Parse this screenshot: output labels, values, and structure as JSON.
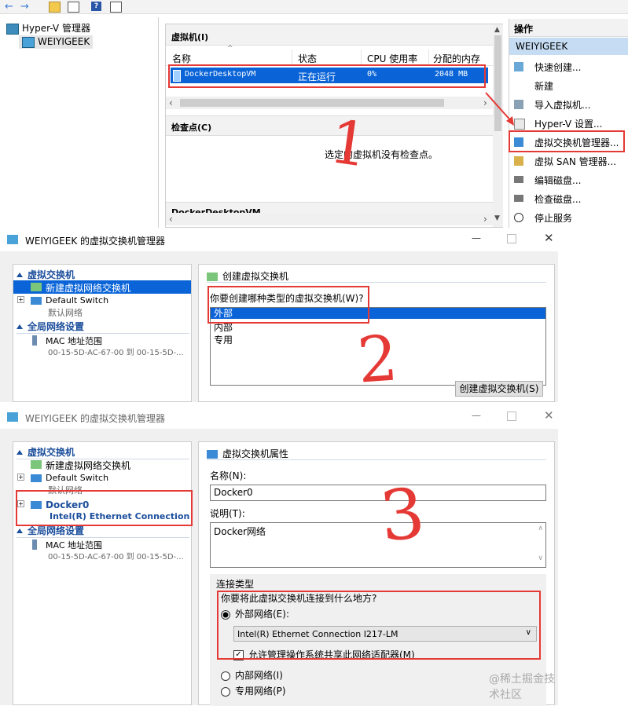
{
  "hv": {
    "tree_root": "Hyper-V 管理器",
    "tree_host": "WEIYIGEEK",
    "vm_section": "虚拟机(I)",
    "columns": [
      "名称",
      "状态",
      "CPU 使用率",
      "分配的内存"
    ],
    "vm_row": {
      "name": "DockerDesktopVM",
      "state": "正在运行",
      "cpu": "0%",
      "mem": "2048 MB"
    },
    "checkpoint_section": "检查点(C)",
    "checkpoint_empty": "选定的虚拟机没有检查点。",
    "details_title": "DockerDesktopVM",
    "actions_title": "操作",
    "actions_host": "WEIYIGEEK",
    "actions": [
      "快速创建...",
      "新建",
      "导入虚拟机...",
      "Hyper-V 设置...",
      "虚拟交换机管理器...",
      "虚拟 SAN 管理器...",
      "编辑磁盘...",
      "检查磁盘...",
      "停止服务"
    ]
  },
  "annotations": [
    "1",
    "2",
    "3"
  ],
  "win2": {
    "title": "WEIYIGEEK 的虚拟交换机管理器",
    "sec_vswitch": "虚拟交换机",
    "new_switch": "新建虚拟网络交换机",
    "default_switch": "Default Switch",
    "default_switch_sub": "默认网络",
    "sec_global": "全局网络设置",
    "mac_range": "MAC 地址范围",
    "mac_value": "00-15-5D-AC-67-00 到 00-15-5D-...",
    "panel_title": "创建虚拟交换机",
    "question": "你要创建哪种类型的虚拟交换机(W)?",
    "types": [
      "外部",
      "内部",
      "专用"
    ],
    "create_btn": "创建虚拟交换机(S)"
  },
  "win3": {
    "title": "WEIYIGEEK 的虚拟交换机管理器",
    "sec_vswitch": "虚拟交换机",
    "new_switch": "新建虚拟网络交换机",
    "default_switch": "Default Switch",
    "default_switch_sub": "默认网络",
    "docker_switch": "Docker0",
    "docker_sub": "Intel(R) Ethernet Connection ...",
    "sec_global": "全局网络设置",
    "mac_range": "MAC 地址范围",
    "mac_value": "00-15-5D-AC-67-00 到 00-15-5D-...",
    "panel_title": "虚拟交换机属性",
    "name_label": "名称(N):",
    "name_value": "Docker0",
    "desc_label": "说明(T):",
    "desc_value": "Docker网络",
    "conn_type": "连接类型",
    "conn_question": "你要将此虚拟交换机连接到什么地方?",
    "external": "外部网络(E):",
    "adapter": "Intel(R) Ethernet Connection I217-LM",
    "allow_share": "允许管理操作系统共享此网络适配器(M)",
    "internal": "内部网络(I)",
    "private": "专用网络(P)"
  },
  "watermark": "@稀土掘金技术社区"
}
